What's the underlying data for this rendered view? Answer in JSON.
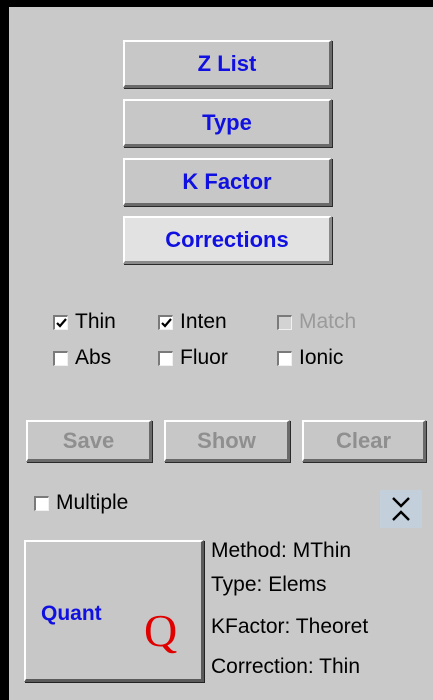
{
  "top_buttons": {
    "z_list": "Z List",
    "type": "Type",
    "k_factor": "K Factor",
    "corrections": "Corrections"
  },
  "options": {
    "thin": {
      "label": "Thin",
      "checked": true
    },
    "inten": {
      "label": "Inten",
      "checked": true
    },
    "match": {
      "label": "Match",
      "checked": false,
      "disabled": true
    },
    "abs": {
      "label": "Abs",
      "checked": false
    },
    "fluor": {
      "label": "Fluor",
      "checked": false
    },
    "ionic": {
      "label": "Ionic",
      "checked": false
    }
  },
  "actions": {
    "save": "Save",
    "show": "Show",
    "clear": "Clear"
  },
  "multiple": {
    "label": "Multiple",
    "checked": false
  },
  "quant": {
    "label": "Quant",
    "icon_letter": "Q"
  },
  "info": {
    "method": "Method:  MThin",
    "type": "Type:  Elems",
    "kfactor": "KFactor:  Theoret",
    "correction": "Correction:  Thin"
  },
  "colors": {
    "panel": "#c9c9c9",
    "button_text": "#1010e0",
    "disabled_text": "#8f8f8f",
    "quant_icon": "#e00000"
  }
}
